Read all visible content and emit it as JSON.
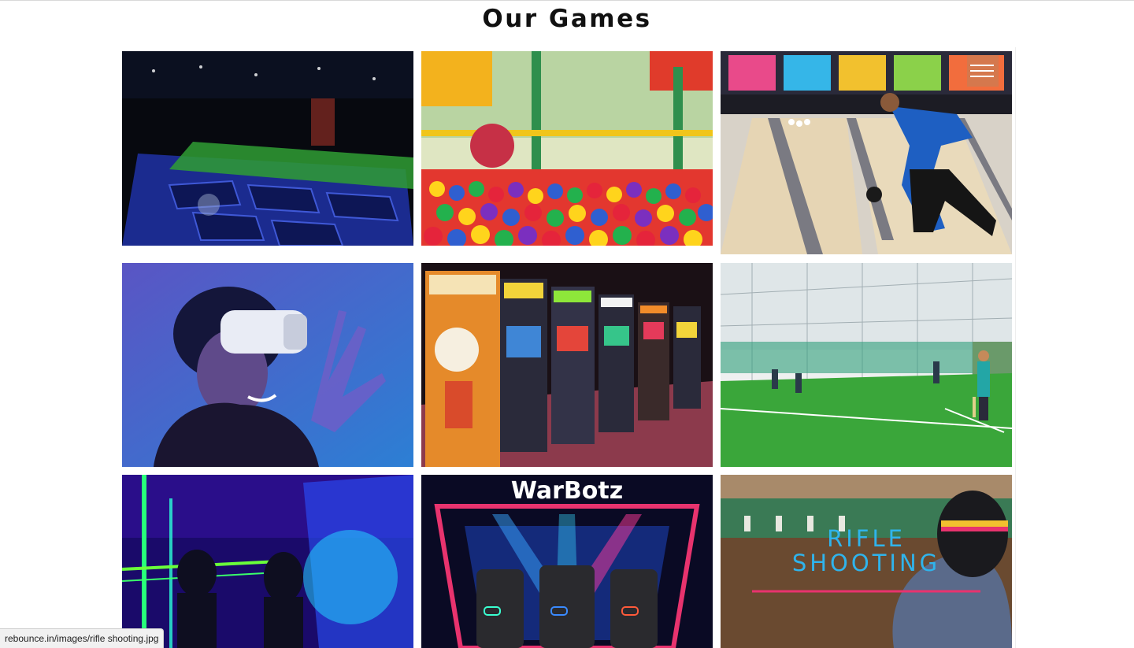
{
  "page": {
    "title": "Our Games"
  },
  "gallery": {
    "tiles": [
      {
        "name": "trampoline-park-tile",
        "subject": "trampoline park"
      },
      {
        "name": "ball-pit-tile",
        "subject": "ball pit"
      },
      {
        "name": "bowling-tile",
        "subject": "bowling"
      },
      {
        "name": "virtual-reality-tile",
        "subject": "virtual reality"
      },
      {
        "name": "arcade-games-tile",
        "subject": "arcade games"
      },
      {
        "name": "box-cricket-tile",
        "subject": "box cricket"
      },
      {
        "name": "laser-tag-tile",
        "subject": "laser tag"
      },
      {
        "name": "warbotz-tile",
        "subject": "robot battle",
        "caption": "WarBotz"
      },
      {
        "name": "rifle-shooting-tile",
        "subject": "rifle shooting",
        "caption_line1": "RIFLE",
        "caption_line2": "SHOOTING"
      }
    ]
  },
  "nav": {
    "menu_icon": "hamburger-icon"
  },
  "status_bar": {
    "url": "rebounce.in/images/rifle shooting.jpg"
  },
  "colors": {
    "caption_blue": "#2fb4ec",
    "underline_pink": "#e8336e",
    "title": "#111111"
  }
}
